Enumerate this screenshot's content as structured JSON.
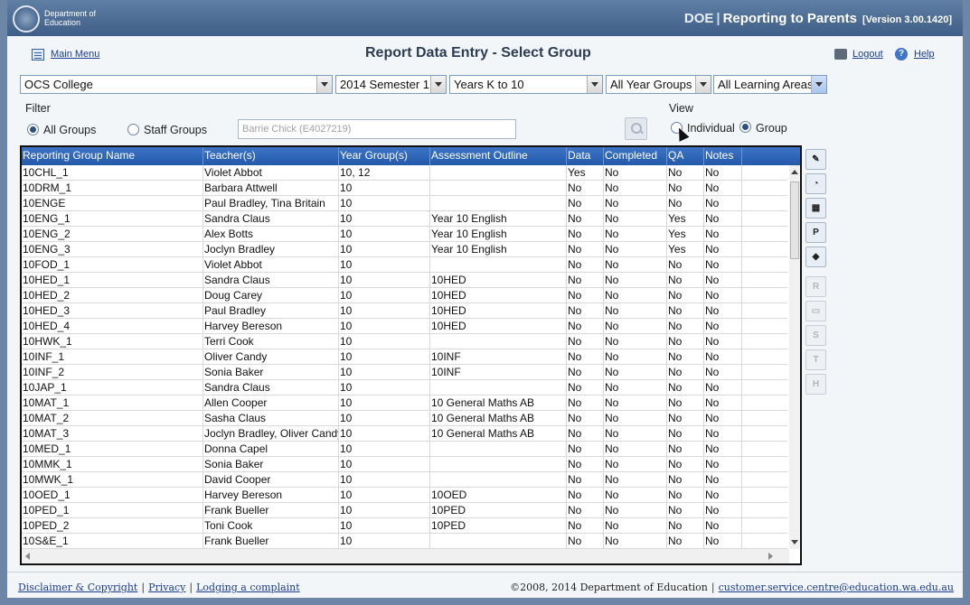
{
  "header": {
    "logo_text_line1": "Department of",
    "logo_text_line2": "Education",
    "app_name_short": "DOE",
    "app_name": "Reporting to Parents",
    "version": "[Version 3.00.1420]"
  },
  "topbar": {
    "main_menu": "Main Menu",
    "page_title": "Report Data Entry - Select Group",
    "logout": "Logout",
    "help": "Help"
  },
  "selectors": {
    "school": "OCS College",
    "semester": "2014 Semester 1",
    "years": "Years K to 10",
    "year_groups": "All Year Groups",
    "learning_areas": "All Learning Areas"
  },
  "filter": {
    "label": "Filter",
    "all_groups": "All Groups",
    "staff_groups": "Staff Groups",
    "staff_placeholder": "Barrie Chick (E4027219)"
  },
  "view": {
    "label": "View",
    "individual": "Individual",
    "group": "Group"
  },
  "table": {
    "columns": [
      "Reporting Group Name",
      "Teacher(s)",
      "Year Group(s)",
      "Assessment Outline",
      "Data",
      "Completed",
      "QA",
      "Notes"
    ],
    "rows": [
      [
        "10CHL_1",
        "Violet Abbot",
        "10, 12",
        "",
        "Yes",
        "No",
        "No",
        "No"
      ],
      [
        "10DRM_1",
        "Barbara Attwell",
        "10",
        "",
        "No",
        "No",
        "No",
        "No"
      ],
      [
        "10ENGE",
        "Paul Bradley, Tina Britain",
        "10",
        "",
        "No",
        "No",
        "No",
        "No"
      ],
      [
        "10ENG_1",
        "Sandra Claus",
        "10",
        "Year 10 English",
        "No",
        "No",
        "Yes",
        "No"
      ],
      [
        "10ENG_2",
        "Alex Botts",
        "10",
        "Year 10 English",
        "No",
        "No",
        "Yes",
        "No"
      ],
      [
        "10ENG_3",
        "Joclyn Bradley",
        "10",
        "Year 10 English",
        "No",
        "No",
        "Yes",
        "No"
      ],
      [
        "10FOD_1",
        "Violet Abbot",
        "10",
        "",
        "No",
        "No",
        "No",
        "No"
      ],
      [
        "10HED_1",
        "Sandra Claus",
        "10",
        "10HED",
        "No",
        "No",
        "No",
        "No"
      ],
      [
        "10HED_2",
        "Doug Carey",
        "10",
        "10HED",
        "No",
        "No",
        "No",
        "No"
      ],
      [
        "10HED_3",
        "Paul Bradley",
        "10",
        "10HED",
        "No",
        "No",
        "No",
        "No"
      ],
      [
        "10HED_4",
        "Harvey Bereson",
        "10",
        "10HED",
        "No",
        "No",
        "No",
        "No"
      ],
      [
        "10HWK_1",
        "Terri Cook",
        "10",
        "",
        "No",
        "No",
        "No",
        "No"
      ],
      [
        "10INF_1",
        "Oliver Candy",
        "10",
        "10INF",
        "No",
        "No",
        "No",
        "No"
      ],
      [
        "10INF_2",
        "Sonia Baker",
        "10",
        "10INF",
        "No",
        "No",
        "No",
        "No"
      ],
      [
        "10JAP_1",
        "Sandra Claus",
        "10",
        "",
        "No",
        "No",
        "No",
        "No"
      ],
      [
        "10MAT_1",
        "Allen Cooper",
        "10",
        "10 General Maths AB",
        "No",
        "No",
        "No",
        "No"
      ],
      [
        "10MAT_2",
        "Sasha Claus",
        "10",
        "10 General Maths AB",
        "No",
        "No",
        "No",
        "No"
      ],
      [
        "10MAT_3",
        "Joclyn Bradley, Oliver Candy",
        "10",
        "10 General Maths AB",
        "No",
        "No",
        "No",
        "No"
      ],
      [
        "10MED_1",
        "Donna Capel",
        "10",
        "",
        "No",
        "No",
        "No",
        "No"
      ],
      [
        "10MMK_1",
        "Sonia Baker",
        "10",
        "",
        "No",
        "No",
        "No",
        "No"
      ],
      [
        "10MWK_1",
        "David Cooper",
        "10",
        "",
        "No",
        "No",
        "No",
        "No"
      ],
      [
        "10OED_1",
        "Harvey Bereson",
        "10",
        "10OED",
        "No",
        "No",
        "No",
        "No"
      ],
      [
        "10PED_1",
        "Frank Bueller",
        "10",
        "10PED",
        "No",
        "No",
        "No",
        "No"
      ],
      [
        "10PED_2",
        "Toni Cook",
        "10",
        "10PED",
        "No",
        "No",
        "No",
        "No"
      ],
      [
        "10S&E_1",
        "Frank Bueller",
        "10",
        "",
        "No",
        "No",
        "No",
        "No"
      ]
    ]
  },
  "tools": [
    {
      "name": "edit-report-icon",
      "glyph": "✎",
      "enabled": true
    },
    {
      "name": "chart-pie-icon",
      "glyph": "◔",
      "enabled": true
    },
    {
      "name": "calendar-icon",
      "glyph": "▦",
      "enabled": true
    },
    {
      "name": "print-p-icon",
      "glyph": "P",
      "enabled": true
    },
    {
      "name": "tag-icon",
      "glyph": "◆",
      "enabled": true
    },
    {
      "name": "print-r-icon",
      "glyph": "R",
      "enabled": false
    },
    {
      "name": "print-blank-icon",
      "glyph": "▭",
      "enabled": false
    },
    {
      "name": "print-s-icon",
      "glyph": "S",
      "enabled": false
    },
    {
      "name": "print-t-icon",
      "glyph": "T",
      "enabled": false
    },
    {
      "name": "print-h-icon",
      "glyph": "H",
      "enabled": false
    }
  ],
  "footer": {
    "disclaimer": "Disclaimer & Copyright",
    "privacy": "Privacy",
    "complaint": "Lodging a complaint",
    "copyright": "©2008, 2014 Department of Education",
    "email": "customer.service.centre@education.wa.edu.au"
  }
}
